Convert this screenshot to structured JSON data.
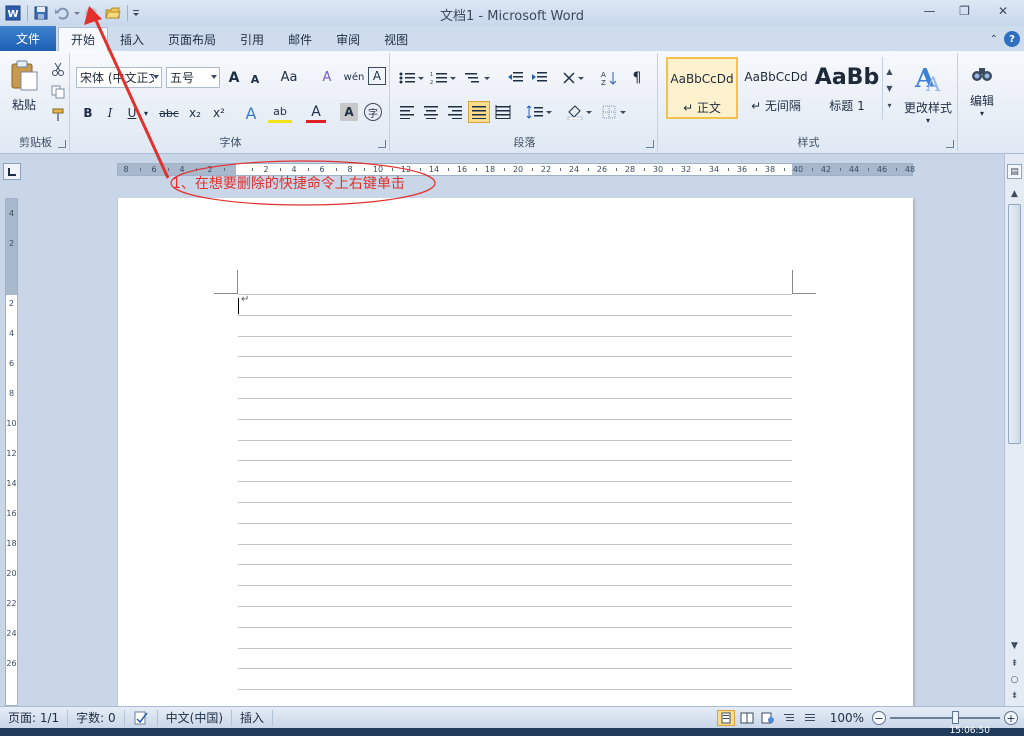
{
  "window": {
    "title": "文档1 - Microsoft Word",
    "buttons": {
      "minimize": "—",
      "restore": "❐",
      "close": "✕"
    }
  },
  "quick_access": {
    "items": [
      "word-app-icon",
      "save-icon",
      "undo-icon",
      "redo-icon",
      "open-icon",
      "customize-icon"
    ]
  },
  "tabs": {
    "file": "文件",
    "items": [
      "开始",
      "插入",
      "页面布局",
      "引用",
      "邮件",
      "审阅",
      "视图"
    ],
    "active_index": 0
  },
  "ribbon": {
    "clipboard": {
      "paste": "粘贴",
      "label": "剪贴板"
    },
    "font": {
      "name": "宋体 (中文正文",
      "size": "五号",
      "label": "字体",
      "buttons": {
        "bold": "B",
        "italic": "I",
        "underline": "U",
        "strike": "abc",
        "subscript": "x₂",
        "superscript": "x²",
        "grow": "A",
        "shrink": "A",
        "change_case": "Aa",
        "clear_format": "A",
        "phonetic": "wén",
        "char_border": "A",
        "text_effect": "A",
        "highlight": "ab",
        "font_color": "A",
        "char_shading": "A",
        "enclose": "字"
      }
    },
    "paragraph": {
      "label": "段落"
    },
    "styles": {
      "label": "样式",
      "items": [
        {
          "sample": "AaBbCcDd",
          "name": "↵ 正文"
        },
        {
          "sample": "AaBbCcDd",
          "name": "↵ 无间隔"
        },
        {
          "sample": "AaBb",
          "name": "标题 1"
        }
      ],
      "change_styles": "更改样式"
    },
    "editing": {
      "label": "编辑"
    }
  },
  "ruler": {
    "numbers": [
      "8",
      "6",
      "4",
      "2",
      "",
      "2",
      "4",
      "6",
      "8",
      "10",
      "12",
      "14",
      "16",
      "18",
      "20",
      "22",
      "24",
      "26",
      "28",
      "30",
      "32",
      "34",
      "36",
      "38",
      "40",
      "42",
      "44",
      "46",
      "48"
    ],
    "vertical_numbers": [
      "4",
      "2",
      "",
      "2",
      "4",
      "6",
      "8",
      "10",
      "12",
      "14",
      "16",
      "18",
      "20",
      "22",
      "24",
      "26"
    ]
  },
  "annotation": {
    "text": "1、在想要删除的快捷命令上右键单击",
    "color": "#e2312d"
  },
  "statusbar": {
    "page": "页面: 1/1",
    "words": "字数: 0",
    "language": "中文(中国)",
    "mode": "插入",
    "zoom": "100%",
    "time": "15:06:50"
  }
}
